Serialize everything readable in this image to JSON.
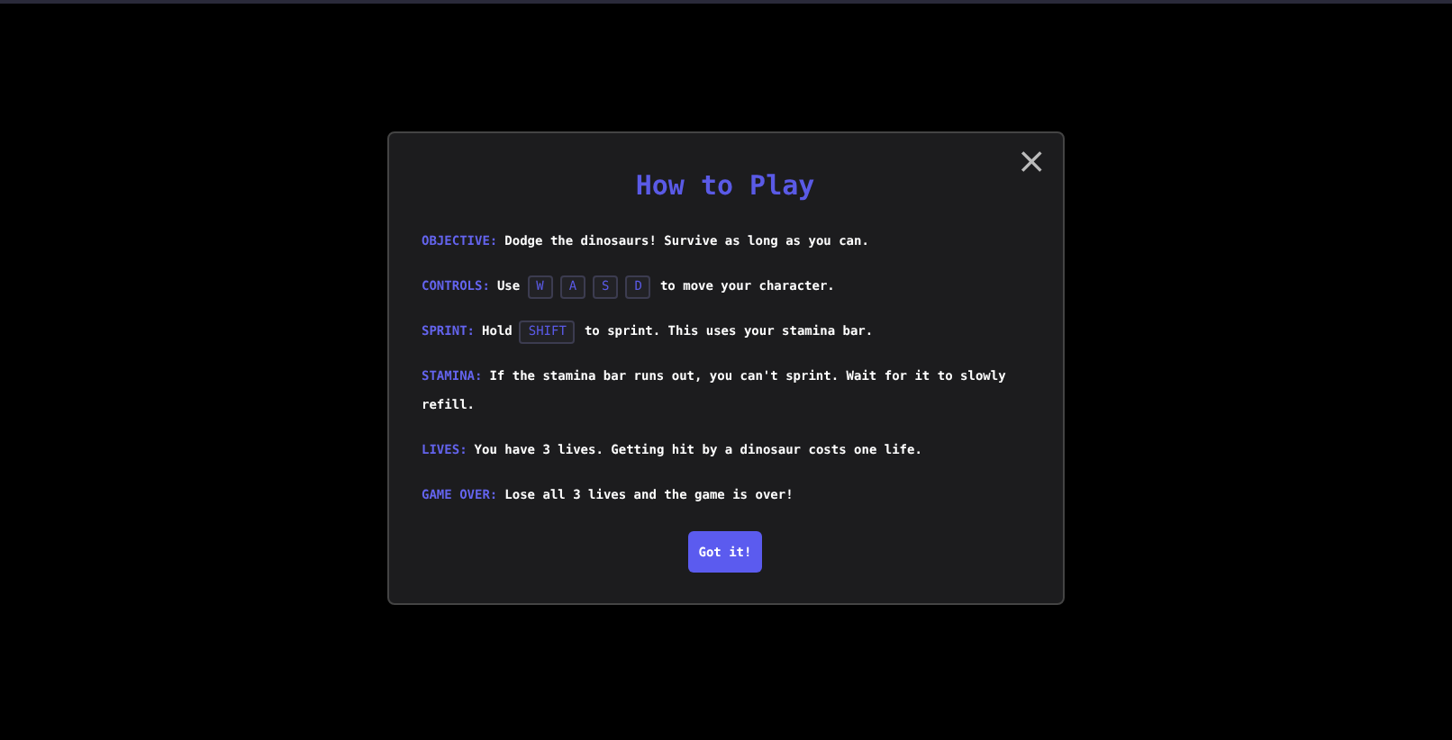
{
  "dialog": {
    "title": "How to Play",
    "close": "×",
    "items": [
      {
        "label": "OBJECTIVE:",
        "parts": [
          {
            "kind": "text",
            "text": "Dodge the dinosaurs! Survive as long as you can."
          }
        ]
      },
      {
        "label": "CONTROLS:",
        "parts": [
          {
            "kind": "text",
            "text": "Use"
          },
          {
            "kind": "key",
            "text": "W"
          },
          {
            "kind": "key",
            "text": "A"
          },
          {
            "kind": "key",
            "text": "S"
          },
          {
            "kind": "key",
            "text": "D"
          },
          {
            "kind": "text",
            "text": "to move your character."
          }
        ]
      },
      {
        "label": "SPRINT:",
        "parts": [
          {
            "kind": "text",
            "text": "Hold"
          },
          {
            "kind": "key",
            "text": "SHIFT"
          },
          {
            "kind": "text",
            "text": "to sprint. This uses your stamina bar."
          }
        ]
      },
      {
        "label": "STAMINA:",
        "parts": [
          {
            "kind": "text",
            "text": "If the stamina bar runs out, you can't sprint. Wait for it to slowly refill."
          }
        ]
      },
      {
        "label": "LIVES:",
        "parts": [
          {
            "kind": "text",
            "text": "You have 3 lives. Getting hit by a dinosaur costs one life."
          }
        ]
      },
      {
        "label": "GAME OVER:",
        "parts": [
          {
            "kind": "text",
            "text": "Lose all 3 lives and the game is over!"
          }
        ]
      }
    ],
    "button": "Got it!"
  }
}
